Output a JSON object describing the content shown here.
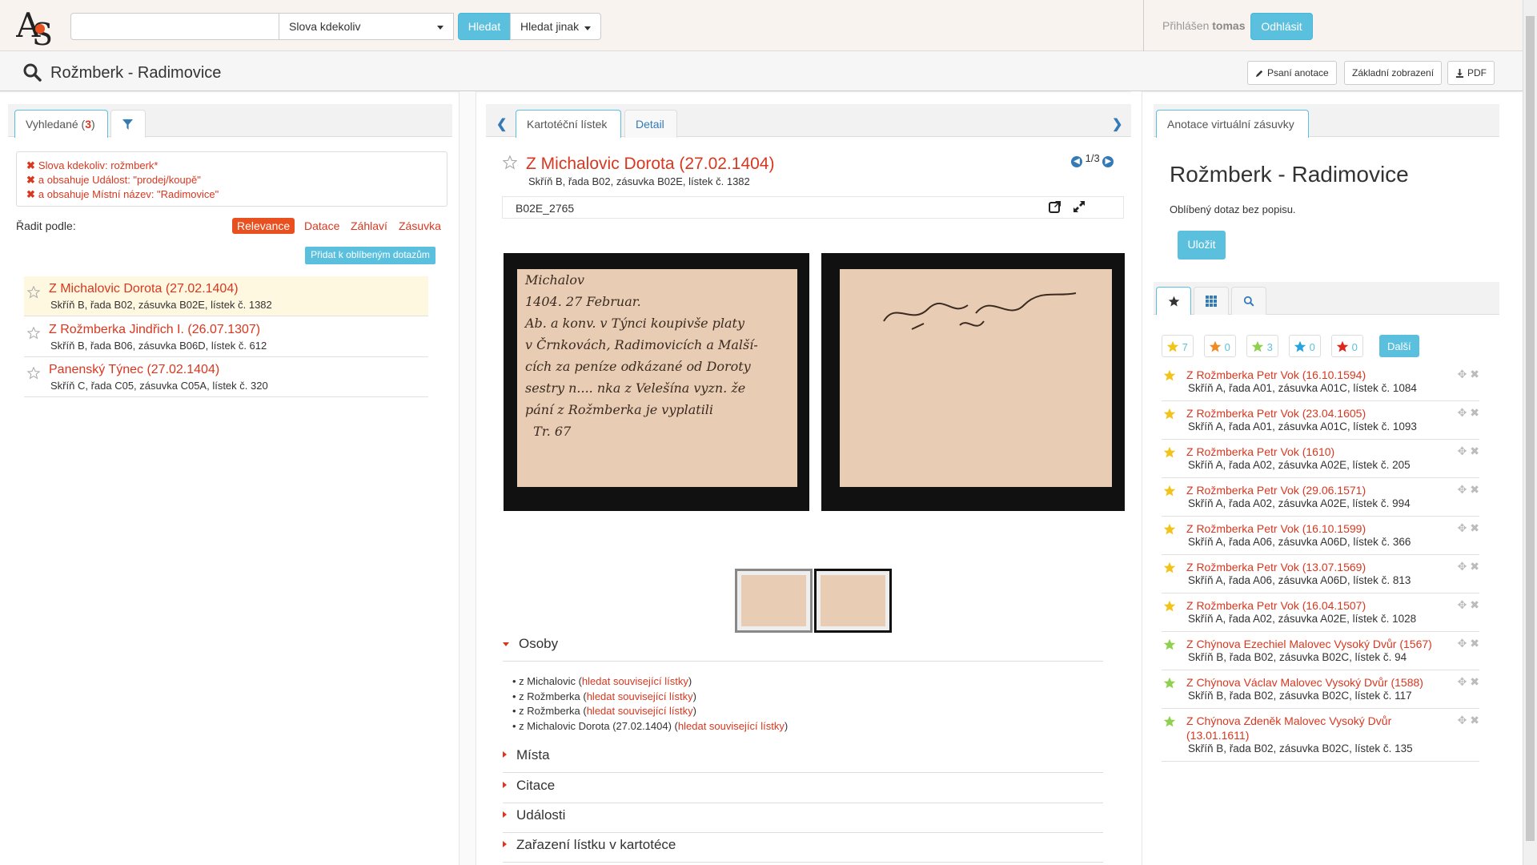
{
  "nav": {
    "scope_select": "Slova kdekoliv",
    "search_button": "Hledat",
    "search_other": "Hledat jinak",
    "user_label": "Přihlášen",
    "user_name": "tomas",
    "logout": "Odhlásit"
  },
  "titlebar": {
    "title": "Rožmberk - Radimovice",
    "btn_annotate": "Psaní anotace",
    "btn_basic_view": "Základní zobrazení",
    "btn_pdf": "PDF"
  },
  "left": {
    "tab_found_label": "Vyhledané (",
    "tab_found_count": "3",
    "tab_found_close": ")",
    "filters": [
      "Slova kdekoliv: rožmberk*",
      "a obsahuje Událost: \"prodej/koupě\"",
      "a obsahuje Místní název: \"Radimovice\""
    ],
    "sort_label": "Řadit podle:",
    "sort_options": [
      "Relevance",
      "Datace",
      "Záhlaví",
      "Zásuvka"
    ],
    "fav_add_button": "Přidat k oblíbeným dotazům",
    "results": [
      {
        "title": "Z Michalovic Dorota (27.02.1404)",
        "sub": "Skříň B, řada B02, zásuvka B02E, lístek č. 1382"
      },
      {
        "title": "Z Rožmberka Jindřich I. (26.07.1307)",
        "sub": "Skříň B, řada B06, zásuvka B06D, lístek č. 612"
      },
      {
        "title": "Panenský Týnec (27.02.1404)",
        "sub": "Skříň C, řada C05, zásuvka C05A, lístek č. 320"
      }
    ]
  },
  "middle": {
    "tab_card": "Kartotéční lístek",
    "tab_detail": "Detail",
    "detail_title": "Z Michalovic Dorota (27.02.1404)",
    "detail_sub": "Skříň B, řada B02, zásuvka B02E, lístek č. 1382",
    "pager": "1/3",
    "code": "B02E_2765",
    "card_front_text": "Michalov\n1404. 27 Februar.\nAb. a konv. v Týnci koupivše platy\nv Črnkovách, Radimovicích a Malší-\ncích za peníze odkázané od Doroty\nsestry n.... nka z Velešína vyzn. že\npání z Rožmberka je vyplatili\n  Tr. 67",
    "sections": {
      "persons": "Osoby",
      "places": "Místa",
      "citations": "Citace",
      "events": "Události",
      "filing": "Zařazení lístku v kartotéce"
    },
    "persons": [
      {
        "name": "z Michalovic",
        "link": "hledat související lístky"
      },
      {
        "name": "z Rožmberka",
        "link": "hledat související lístky"
      },
      {
        "name": "z Rožmberka",
        "link": "hledat související lístky"
      },
      {
        "name": "z Michalovic Dorota (27.02.1404)",
        "link": "hledat související lístky"
      }
    ]
  },
  "right": {
    "tab_annot": "Anotace virtuální zásuvky",
    "fav_title": "Rožmberk - Radimovice",
    "fav_desc": "Oblíbený dotaz bez popisu.",
    "save_button": "Uložit",
    "ratings": [
      {
        "color": "#f0c419",
        "count": "7"
      },
      {
        "color": "#f08a24",
        "count": "0"
      },
      {
        "color": "#8fd14f",
        "count": "3"
      },
      {
        "color": "#29a3e0",
        "count": "0"
      },
      {
        "color": "#e0251b",
        "count": "0"
      }
    ],
    "more_button": "Další",
    "items": [
      {
        "star": "#f0c419",
        "title": "Z Rožmberka Petr Vok (16.10.1594)",
        "sub": "Skříň A, řada A01, zásuvka A01C, lístek č. 1084"
      },
      {
        "star": "#f0c419",
        "title": "Z Rožmberka Petr Vok (23.04.1605)",
        "sub": "Skříň A, řada A01, zásuvka A01C, lístek č. 1093"
      },
      {
        "star": "#f0c419",
        "title": "Z Rožmberka Petr Vok (1610)",
        "sub": "Skříň A, řada A02, zásuvka A02E, lístek č. 205"
      },
      {
        "star": "#f0c419",
        "title": "Z Rožmberka Petr Vok (29.06.1571)",
        "sub": "Skříň A, řada A02, zásuvka A02E, lístek č. 994"
      },
      {
        "star": "#f0c419",
        "title": "Z Rožmberka Petr Vok (16.10.1599)",
        "sub": "Skříň A, řada A06, zásuvka A06D, lístek č. 366"
      },
      {
        "star": "#f0c419",
        "title": "Z Rožmberka Petr Vok (13.07.1569)",
        "sub": "Skříň A, řada A06, zásuvka A06D, lístek č. 813"
      },
      {
        "star": "#f0c419",
        "title": "Z Rožmberka Petr Vok (16.04.1507)",
        "sub": "Skříň A, řada A02, zásuvka A02E, lístek č. 1028"
      },
      {
        "star": "#8fd14f",
        "title": "Z Chýnova Ezechiel Malovec Vysoký Dvůr (1567)",
        "sub": "Skříň B, řada B02, zásuvka B02C, lístek č. 94"
      },
      {
        "star": "#8fd14f",
        "title": "Z Chýnova Václav Malovec Vysoký Dvůr (1588)",
        "sub": "Skříň B, řada B02, zásuvka B02C, lístek č. 117"
      },
      {
        "star": "#8fd14f",
        "title": "Z Chýnova Zdeněk Malovec Vysoký Dvůr (13.01.1611)",
        "sub": "Skříň B, řada B02, zásuvka B02C, lístek č. 135"
      }
    ]
  },
  "colors": {
    "accent_red": "#d9371f",
    "accent_blue": "#5bc0de",
    "sort_active": "#e8501f"
  },
  "icons": {
    "search": "search-icon",
    "filter": "filter-icon",
    "star_empty": "star-outline-icon",
    "pencil": "pencil-icon",
    "download": "download-icon",
    "external": "external-link-icon",
    "expand": "expand-icon",
    "grid": "grid-icon",
    "move": "move-icon",
    "remove": "remove-icon"
  }
}
